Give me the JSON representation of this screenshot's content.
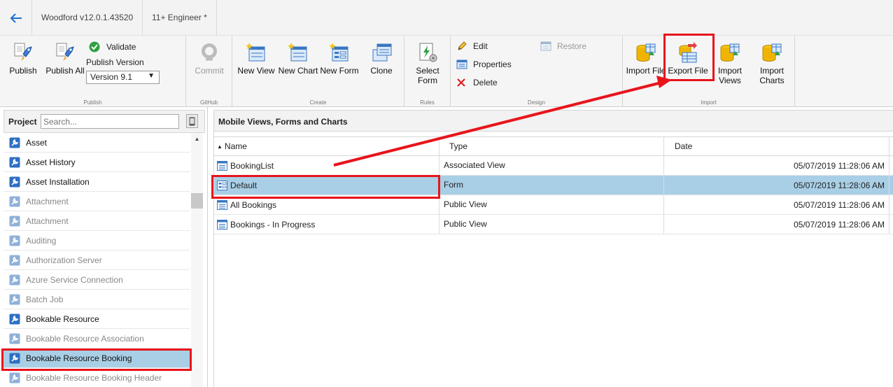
{
  "topbar": {
    "back_icon": "arrow-left-icon",
    "app_version": "Woodford v12.0.1.43520",
    "project_tab": "11+ Engineer *"
  },
  "ribbon": {
    "publish_group": {
      "label": "Publish",
      "publish": "Publish",
      "publish_all": "Publish All",
      "validate": "Validate",
      "publish_version": "Publish Version",
      "version_value": "Version 9.1"
    },
    "github_group": {
      "label": "GitHub",
      "commit": "Commit"
    },
    "create_group": {
      "label": "Create",
      "new_view": "New View",
      "new_chart": "New Chart",
      "new_form": "New Form",
      "clone": "Clone"
    },
    "rules_group": {
      "label": "Rules",
      "select_form": [
        "Select",
        "Form"
      ]
    },
    "design_group": {
      "label": "Design",
      "edit": "Edit",
      "properties": "Properties",
      "delete": "Delete",
      "restore": "Restore"
    },
    "import_group": {
      "label": "Import",
      "import_file": "Import File",
      "export_file": "Export File",
      "import_views": [
        "Import",
        "Views"
      ],
      "import_charts": [
        "Import",
        "Charts"
      ]
    }
  },
  "left_panel": {
    "title": "Project",
    "search_placeholder": "Search...",
    "entities": [
      {
        "label": "Asset",
        "enabled": true,
        "selected": false
      },
      {
        "label": "Asset History",
        "enabled": true,
        "selected": false
      },
      {
        "label": "Asset Installation",
        "enabled": true,
        "selected": false
      },
      {
        "label": "Attachment",
        "enabled": false,
        "selected": false
      },
      {
        "label": "Attachment",
        "enabled": false,
        "selected": false
      },
      {
        "label": "Auditing",
        "enabled": false,
        "selected": false
      },
      {
        "label": "Authorization Server",
        "enabled": false,
        "selected": false
      },
      {
        "label": "Azure Service Connection",
        "enabled": false,
        "selected": false
      },
      {
        "label": "Batch Job",
        "enabled": false,
        "selected": false
      },
      {
        "label": "Bookable Resource",
        "enabled": true,
        "selected": false
      },
      {
        "label": "Bookable Resource Association",
        "enabled": false,
        "selected": false
      },
      {
        "label": "Bookable Resource Booking",
        "enabled": true,
        "selected": true
      },
      {
        "label": "Bookable Resource Booking Header",
        "enabled": false,
        "selected": false
      }
    ]
  },
  "main": {
    "title": "Mobile Views, Forms and Charts",
    "columns": {
      "name": "Name",
      "type": "Type",
      "date": "Date",
      "sort_icon": "sort-ascending-icon"
    },
    "rows": [
      {
        "name": "BookingList",
        "type": "Associated View",
        "date": "05/07/2019 11:28:06 AM",
        "icon": "view-icon",
        "selected": false
      },
      {
        "name": "Default",
        "type": "Form",
        "date": "05/07/2019 11:28:06 AM",
        "icon": "form-icon",
        "selected": true
      },
      {
        "name": "All Bookings",
        "type": "Public View",
        "date": "05/07/2019 11:28:06 AM",
        "icon": "view-icon",
        "selected": false
      },
      {
        "name": "Bookings - In Progress",
        "type": "Public View",
        "date": "05/07/2019 11:28:06 AM",
        "icon": "view-icon",
        "selected": false
      }
    ]
  },
  "colors": {
    "accent_blue": "#1e6fd0",
    "selection": "#a9cfe6",
    "annotation_red": "#e8141c"
  }
}
